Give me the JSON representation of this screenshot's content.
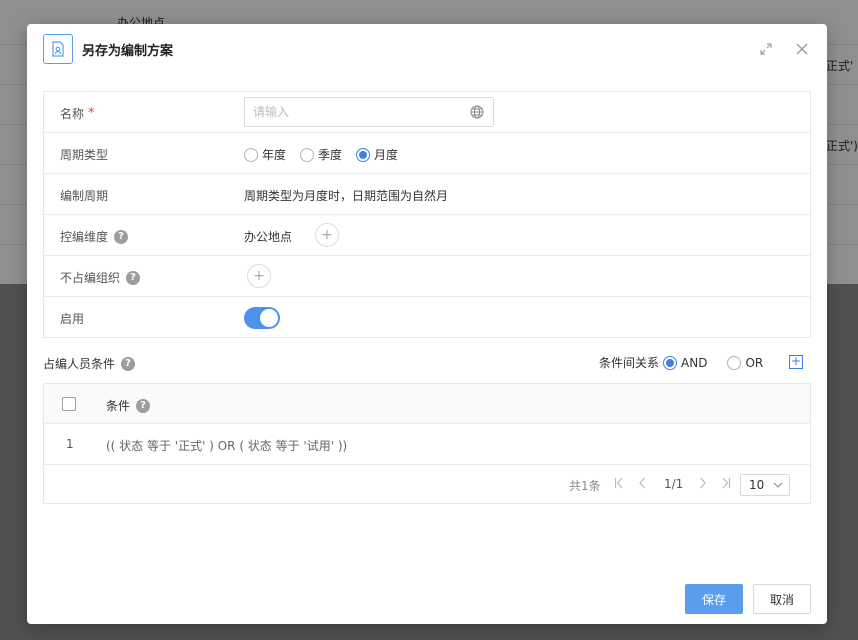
{
  "background": {
    "row1_text": "办公地点",
    "right_text_1": "正式'",
    "right_text_2": "正式')"
  },
  "dialog": {
    "title": "另存为编制方案",
    "icons": {
      "header": "document-user-icon",
      "expand": "expand-icon",
      "close": "close-icon"
    }
  },
  "form": {
    "name": {
      "label": "名称",
      "required_mark": "*",
      "placeholder": "请输入",
      "value": ""
    },
    "period_type": {
      "label": "周期类型",
      "options": [
        "年度",
        "季度",
        "月度"
      ],
      "selected": "月度"
    },
    "period": {
      "label": "编制周期",
      "value": "周期类型为月度时，日期范围为自然月"
    },
    "control_dimension": {
      "label": "控编维度",
      "value": "办公地点"
    },
    "excluded_org": {
      "label": "不占编组织"
    },
    "enabled": {
      "label": "启用",
      "value": true
    }
  },
  "conditions": {
    "title": "占编人员条件",
    "relation_label": "条件间关系",
    "relation_options": [
      "AND",
      "OR"
    ],
    "relation_selected": "AND",
    "table": {
      "header": "条件",
      "rows": [
        {
          "index": "1",
          "condition": "(( 状态 等于 '正式' ) OR ( 状态 等于 '试用' ))"
        }
      ]
    },
    "pagination": {
      "total": "共1条",
      "page": "1/1",
      "page_size": "10"
    }
  },
  "buttons": {
    "save": "保存",
    "cancel": "取消"
  },
  "colors": {
    "primary": "#4e93ea",
    "required": "#e2463b"
  }
}
